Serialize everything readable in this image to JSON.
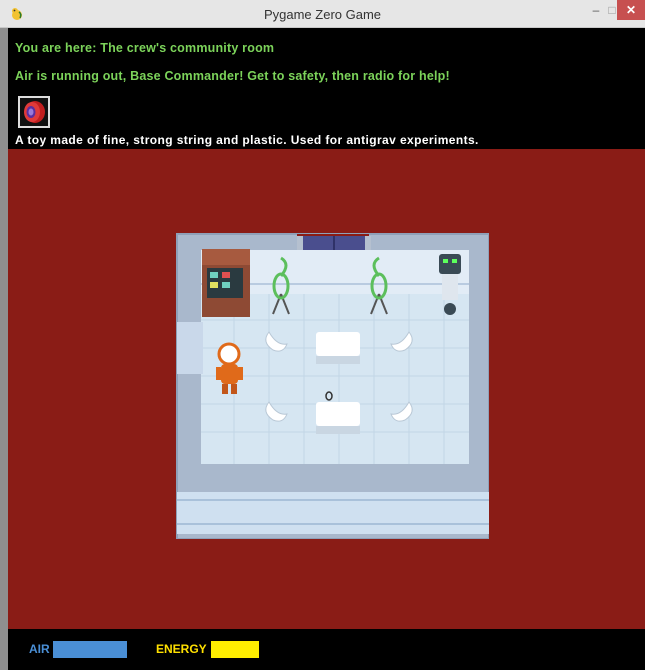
{
  "window": {
    "title": "Pygame Zero Game",
    "minimize_glyph": "–",
    "maximize_glyph": "□",
    "close_glyph": "✕"
  },
  "hud": {
    "location_text": "You are here: The crew's community room",
    "message_text": "Air is running out, Base Commander! Get to safety, then radio for help!",
    "selected_item_icon": "yoyo-icon",
    "item_description": "A toy made of fine, strong string and plastic. Used for antigrav experiments."
  },
  "status": {
    "air_label": "AIR",
    "energy_label": "ENERGY"
  },
  "colors": {
    "hud_text": "#7cd35a",
    "playfield_background": "#8a1c16",
    "air": "#4a8fd6",
    "energy": "#ffee00"
  }
}
